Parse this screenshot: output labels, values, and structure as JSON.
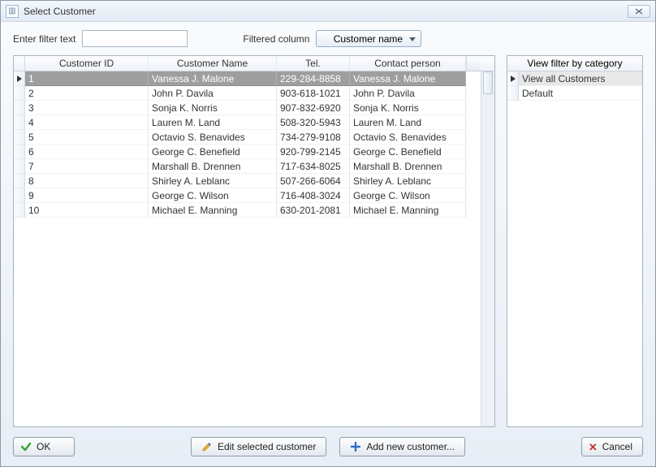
{
  "window": {
    "title": "Select Customer"
  },
  "filter": {
    "label": "Enter filter text",
    "value": "",
    "column_label": "Filtered column",
    "column_selected": "Customer name"
  },
  "grid": {
    "columns": {
      "id": "Customer ID",
      "name": "Customer Name",
      "tel": "Tel.",
      "contact": "Contact person"
    },
    "rows": [
      {
        "id": "1",
        "name": "Vanessa J. Malone",
        "tel": "229-284-8858",
        "contact": "Vanessa J. Malone"
      },
      {
        "id": "2",
        "name": "John P. Davila",
        "tel": "903-618-1021",
        "contact": "John P. Davila"
      },
      {
        "id": "3",
        "name": "Sonja K. Norris",
        "tel": "907-832-6920",
        "contact": "Sonja K. Norris"
      },
      {
        "id": "4",
        "name": "Lauren M. Land",
        "tel": "508-320-5943",
        "contact": "Lauren M. Land"
      },
      {
        "id": "5",
        "name": "Octavio S. Benavides",
        "tel": "734-279-9108",
        "contact": "Octavio S. Benavides"
      },
      {
        "id": "6",
        "name": "George C. Benefield",
        "tel": "920-799-2145",
        "contact": "George C. Benefield"
      },
      {
        "id": "7",
        "name": "Marshall B. Drennen",
        "tel": "717-634-8025",
        "contact": "Marshall B. Drennen"
      },
      {
        "id": "8",
        "name": "Shirley A. Leblanc",
        "tel": "507-266-6064",
        "contact": "Shirley A. Leblanc"
      },
      {
        "id": "9",
        "name": "George C. Wilson",
        "tel": "716-408-3024",
        "contact": "George C. Wilson"
      },
      {
        "id": "10",
        "name": "Michael E. Manning",
        "tel": "630-201-2081",
        "contact": "Michael E. Manning"
      }
    ],
    "selected_index": 0
  },
  "category_panel": {
    "header": "View filter by category",
    "rows": [
      {
        "label": "View all Customers"
      },
      {
        "label": "Default"
      }
    ],
    "selected_index": 0
  },
  "buttons": {
    "ok": "OK",
    "edit": "Edit selected customer",
    "add": "Add new customer...",
    "cancel": "Cancel"
  }
}
